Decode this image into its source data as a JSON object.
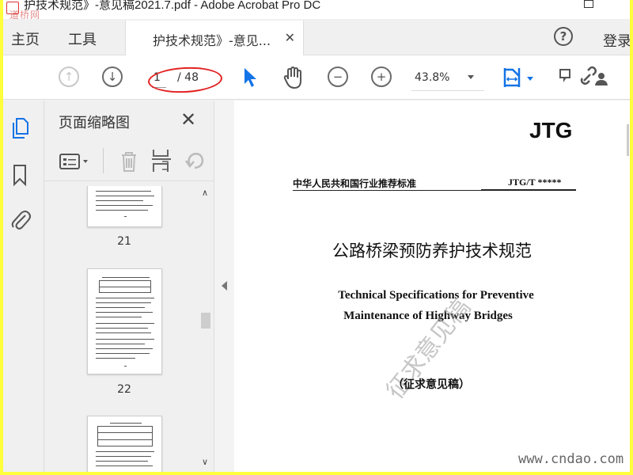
{
  "window": {
    "title": "护技术规范》-意见稿2021.7.pdf - Adobe Acrobat Pro DC",
    "watermark": "道桥网"
  },
  "tabs": {
    "home": "主页",
    "tools": "工具",
    "document": "护技术规范》-意见...",
    "close": "✕",
    "help": "?",
    "sign_in": "登录"
  },
  "toolbar": {
    "current_page": "1",
    "total_pages": "/ 48",
    "zoom": "43.8%",
    "icons": [
      "page-up-icon",
      "page-down-icon",
      "select-arrow-icon",
      "hand-icon",
      "zoom-out-icon",
      "zoom-in-icon",
      "fit-page-icon",
      "comment-icon",
      "share-link-icon"
    ]
  },
  "left_strip": {
    "icons": [
      "page-thumbnails-icon",
      "bookmark-icon",
      "attachment-icon"
    ]
  },
  "thumbnails_panel": {
    "title": "页面缩略图",
    "close": "✕",
    "pages": [
      "21",
      "22",
      ""
    ]
  },
  "document": {
    "logo": "JTG",
    "header_left": "中华人民共和国行业推荐标准",
    "header_right": "JTG/T *****",
    "title_cn": "公路桥梁预防养护技术规范",
    "title_en_line1": "Technical Specifications for Preventive",
    "title_en_line2": "Maintenance of Highway Bridges",
    "stamp": "征求意见稿",
    "draft_label": "（征求意见稿）"
  },
  "footer_watermark": "www.cndao.com",
  "colors": {
    "frame_border": "#ffff3c",
    "annotation_oval": "#e32323",
    "accent_blue": "#1473e6"
  }
}
